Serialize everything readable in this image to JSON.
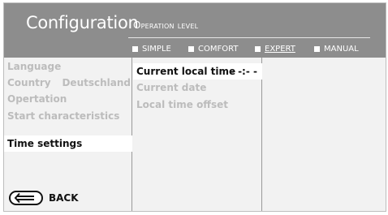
{
  "header": {
    "title": "Configuration",
    "operation_level": {
      "heading": "Operation level",
      "options": [
        {
          "label": "SIMPLE",
          "selected": false
        },
        {
          "label": "COMFORT",
          "selected": false
        },
        {
          "label": "EXPERT",
          "selected": true
        },
        {
          "label": "MANUAL",
          "selected": false
        }
      ]
    }
  },
  "menu": {
    "items": [
      {
        "label": "Language",
        "value": "",
        "active": false
      },
      {
        "label": "Country",
        "value": "Deutschland",
        "active": false
      },
      {
        "label": "Opertation",
        "value": "",
        "active": false
      },
      {
        "label": "Start characteristics",
        "value": "",
        "active": false
      },
      {
        "label": "Time settings",
        "value": "",
        "active": true
      }
    ]
  },
  "submenu": {
    "items": [
      {
        "label": "Current local time",
        "value": "- -:- -",
        "active": true
      },
      {
        "label": "Current date",
        "value": "",
        "active": false
      },
      {
        "label": "Local time offset",
        "value": "",
        "active": false
      }
    ]
  },
  "footer": {
    "back_label": "BACK",
    "back_icon": "back-arrow-icon"
  },
  "colors": {
    "header_bg": "#8d8d8d",
    "panel_bg": "#f2f2f2",
    "highlight_bg": "#ffffff",
    "disabled_text": "#bcbcbc",
    "active_text": "#111111"
  }
}
